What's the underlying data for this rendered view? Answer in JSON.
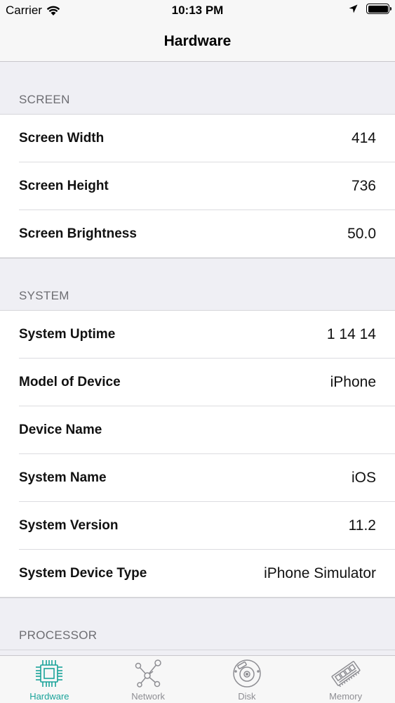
{
  "status_bar": {
    "carrier": "Carrier",
    "time": "10:13 PM"
  },
  "nav": {
    "title": "Hardware"
  },
  "sections": [
    {
      "header": "SCREEN",
      "rows": [
        {
          "label": "Screen Width",
          "value": "414"
        },
        {
          "label": "Screen Height",
          "value": "736"
        },
        {
          "label": "Screen Brightness",
          "value": "50.0"
        }
      ]
    },
    {
      "header": "SYSTEM",
      "rows": [
        {
          "label": "System Uptime",
          "value": "1 14 14"
        },
        {
          "label": "Model of Device",
          "value": "iPhone"
        },
        {
          "label": "Device Name",
          "value": ""
        },
        {
          "label": "System Name",
          "value": "iOS"
        },
        {
          "label": "System Version",
          "value": "11.2"
        },
        {
          "label": "System Device Type",
          "value": "iPhone Simulator"
        }
      ]
    },
    {
      "header": "PROCESSOR",
      "rows": []
    }
  ],
  "tabs": [
    {
      "label": "Hardware",
      "icon": "cpu-chip-icon",
      "active": true
    },
    {
      "label": "Network",
      "icon": "network-nodes-icon",
      "active": false
    },
    {
      "label": "Disk",
      "icon": "disk-icon",
      "active": false
    },
    {
      "label": "Memory",
      "icon": "memory-module-icon",
      "active": false
    }
  ],
  "colors": {
    "accent": "#1aa39a",
    "inactive": "#8e8e93",
    "background": "#efeff4"
  }
}
